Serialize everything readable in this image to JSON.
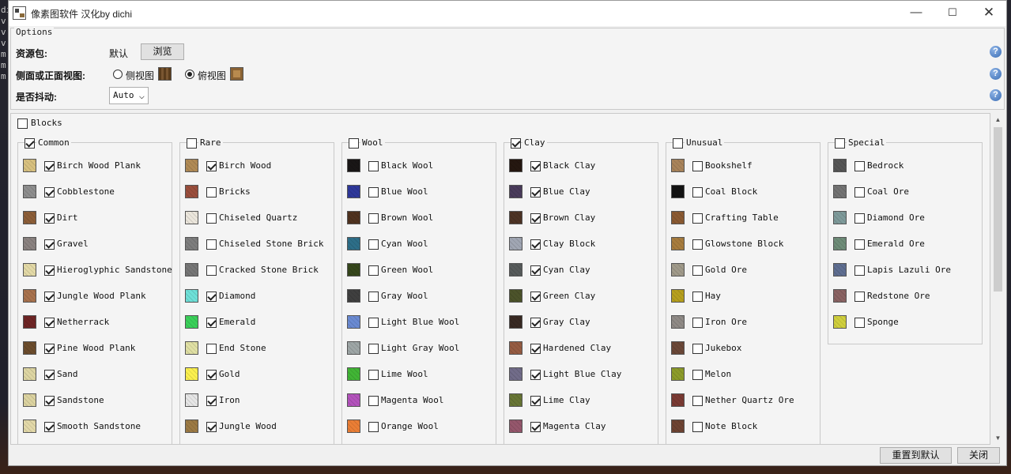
{
  "window": {
    "title": "像素图软件 汉化by dichi",
    "min": "—",
    "max": "☐",
    "close": "✕"
  },
  "desktop": {
    "lines": [
      "di",
      "v",
      "v",
      "v",
      "m",
      "m",
      "m"
    ]
  },
  "options": {
    "legend": "Options",
    "resource_pack": {
      "label": "资源包:",
      "value": "默认",
      "browse": "浏览"
    },
    "view": {
      "label": "侧面或正面视图:",
      "side_label": "侧视图",
      "top_label": "俯视图",
      "selected": "top"
    },
    "dither": {
      "label": "是否抖动:",
      "value": "Auto"
    }
  },
  "blocks": {
    "label": "Blocks",
    "checked": false,
    "groups": [
      {
        "name": "Common",
        "checked": true,
        "items": [
          {
            "label": "Birch Wood Plank",
            "checked": true,
            "color": "#d7c07f"
          },
          {
            "label": "Cobblestone",
            "checked": true,
            "color": "#8e8e8e"
          },
          {
            "label": "Dirt",
            "checked": true,
            "color": "#8c5e38"
          },
          {
            "label": "Gravel",
            "checked": true,
            "color": "#8a8280"
          },
          {
            "label": "Hieroglyphic Sandstone",
            "checked": true,
            "color": "#e3d9a6"
          },
          {
            "label": "Jungle Wood Plank",
            "checked": true,
            "color": "#a8724d"
          },
          {
            "label": "Netherrack",
            "checked": true,
            "color": "#6e2525"
          },
          {
            "label": "Pine Wood Plank",
            "checked": true,
            "color": "#6b4c2c"
          },
          {
            "label": "Sand",
            "checked": true,
            "color": "#ddd5a2"
          },
          {
            "label": "Sandstone",
            "checked": true,
            "color": "#dcd3a0"
          },
          {
            "label": "Smooth Sandstone",
            "checked": true,
            "color": "#e2d8a8"
          }
        ]
      },
      {
        "name": "Rare",
        "checked": false,
        "items": [
          {
            "label": "Birch Wood",
            "checked": true,
            "color": "#b08a55"
          },
          {
            "label": "Bricks",
            "checked": false,
            "color": "#9a4e3c"
          },
          {
            "label": "Chiseled Quartz",
            "checked": false,
            "color": "#ebe6dc"
          },
          {
            "label": "Chiseled Stone Brick",
            "checked": false,
            "color": "#7d7d7d"
          },
          {
            "label": "Cracked Stone Brick",
            "checked": false,
            "color": "#767676"
          },
          {
            "label": "Diamond",
            "checked": true,
            "color": "#6ee0d8"
          },
          {
            "label": "Emerald",
            "checked": true,
            "color": "#3bd05a"
          },
          {
            "label": "End Stone",
            "checked": false,
            "color": "#e0e0a4"
          },
          {
            "label": "Gold",
            "checked": true,
            "color": "#fbf04e"
          },
          {
            "label": "Iron",
            "checked": true,
            "color": "#e6e6e6"
          },
          {
            "label": "Jungle Wood",
            "checked": true,
            "color": "#9c7a44"
          }
        ]
      },
      {
        "name": "Wool",
        "checked": false,
        "items": [
          {
            "label": "Black Wool",
            "checked": false,
            "color": "#191616"
          },
          {
            "label": "Blue Wool",
            "checked": false,
            "color": "#2e389a"
          },
          {
            "label": "Brown Wool",
            "checked": false,
            "color": "#4f321f"
          },
          {
            "label": "Cyan Wool",
            "checked": false,
            "color": "#2d6e88"
          },
          {
            "label": "Green Wool",
            "checked": false,
            "color": "#35461b"
          },
          {
            "label": "Gray Wool",
            "checked": false,
            "color": "#3f3f3f"
          },
          {
            "label": "Light Blue Wool",
            "checked": false,
            "color": "#6a8ad2"
          },
          {
            "label": "Light Gray Wool",
            "checked": false,
            "color": "#9ea6a6"
          },
          {
            "label": "Lime Wool",
            "checked": false,
            "color": "#41b535"
          },
          {
            "label": "Magenta Wool",
            "checked": false,
            "color": "#b352bc"
          },
          {
            "label": "Orange Wool",
            "checked": false,
            "color": "#ea7e35"
          }
        ]
      },
      {
        "name": "Clay",
        "checked": true,
        "items": [
          {
            "label": "Black Clay",
            "checked": true,
            "color": "#251710"
          },
          {
            "label": "Blue Clay",
            "checked": true,
            "color": "#4a3b5b"
          },
          {
            "label": "Brown Clay",
            "checked": true,
            "color": "#4d3324"
          },
          {
            "label": "Clay Block",
            "checked": true,
            "color": "#a0a6b3"
          },
          {
            "label": "Cyan Clay",
            "checked": true,
            "color": "#575b5b"
          },
          {
            "label": "Green Clay",
            "checked": true,
            "color": "#4c532a"
          },
          {
            "label": "Gray Clay",
            "checked": true,
            "color": "#392a23"
          },
          {
            "label": "Hardened Clay",
            "checked": true,
            "color": "#965c42"
          },
          {
            "label": "Light Blue Clay",
            "checked": true,
            "color": "#716c89"
          },
          {
            "label": "Lime Clay",
            "checked": true,
            "color": "#677534"
          },
          {
            "label": "Magenta Clay",
            "checked": true,
            "color": "#95576c"
          }
        ]
      },
      {
        "name": "Unusual",
        "checked": false,
        "items": [
          {
            "label": "Bookshelf",
            "checked": false,
            "color": "#a8835a"
          },
          {
            "label": "Coal Block",
            "checked": false,
            "color": "#131313"
          },
          {
            "label": "Crafting Table",
            "checked": false,
            "color": "#8a5a32"
          },
          {
            "label": "Glowstone Block",
            "checked": false,
            "color": "#a77c3e"
          },
          {
            "label": "Gold Ore",
            "checked": false,
            "color": "#a09a8a"
          },
          {
            "label": "Hay",
            "checked": false,
            "color": "#b69f1d"
          },
          {
            "label": "Iron Ore",
            "checked": false,
            "color": "#8f8a86"
          },
          {
            "label": "Jukebox",
            "checked": false,
            "color": "#6b4838"
          },
          {
            "label": "Melon",
            "checked": false,
            "color": "#8c9b2a"
          },
          {
            "label": "Nether Quartz Ore",
            "checked": false,
            "color": "#7a3a33"
          },
          {
            "label": "Note Block",
            "checked": false,
            "color": "#6d4332"
          }
        ]
      },
      {
        "name": "Special",
        "checked": false,
        "items": [
          {
            "label": "Bedrock",
            "checked": false,
            "color": "#555555"
          },
          {
            "label": "Coal Ore",
            "checked": false,
            "color": "#737373"
          },
          {
            "label": "Diamond Ore",
            "checked": false,
            "color": "#7e9a9a"
          },
          {
            "label": "Emerald Ore",
            "checked": false,
            "color": "#6e8c78"
          },
          {
            "label": "Lapis Lazuli Ore",
            "checked": false,
            "color": "#5f6e91"
          },
          {
            "label": "Redstone Ore",
            "checked": false,
            "color": "#8a6363"
          },
          {
            "label": "Sponge",
            "checked": false,
            "color": "#d0cf3d"
          }
        ]
      }
    ]
  },
  "footer": {
    "reset": "重置到默认",
    "close": "关闭"
  }
}
